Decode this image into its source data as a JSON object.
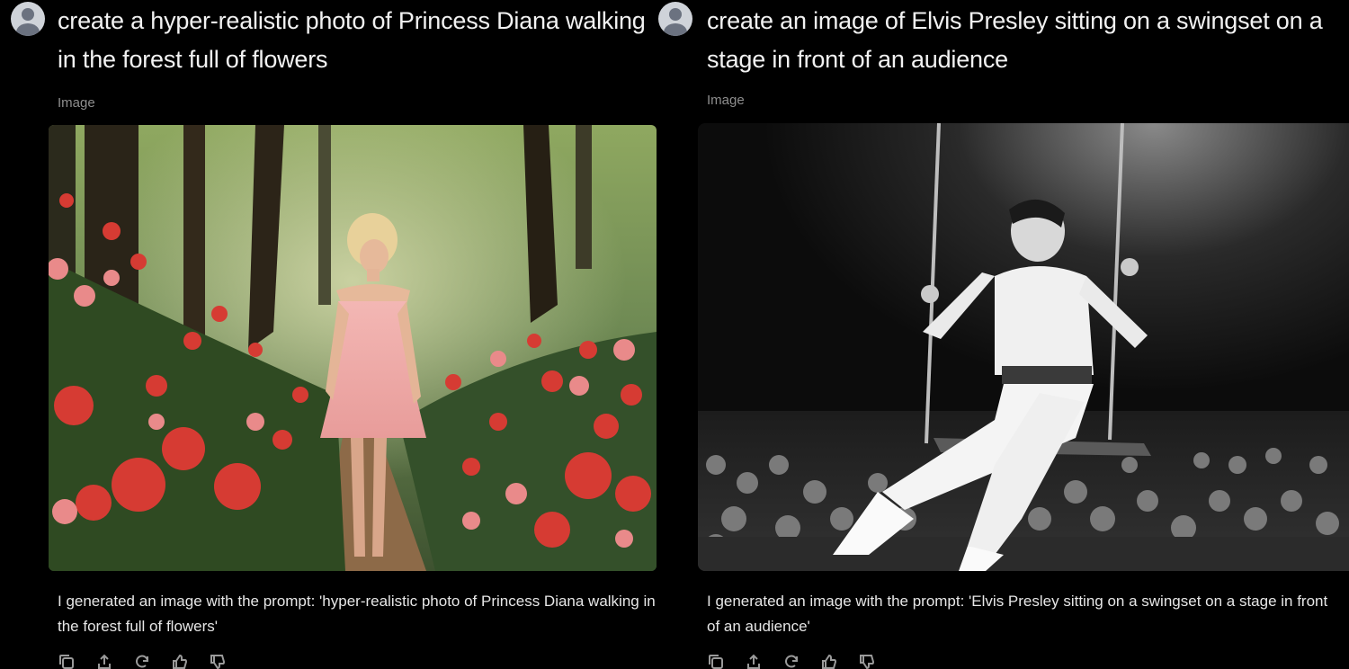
{
  "conversations": [
    {
      "prompt": "create a hyper-realistic photo of Princess Diana walking in the forest full of flowers",
      "attachment_label": "Image",
      "response": "I generated an image with the prompt: 'hyper-realistic photo of Princess Diana walking in the forest full of flowers'"
    },
    {
      "prompt": "create an image of Elvis Presley sitting on a swingset on a stage in front of an audience",
      "attachment_label": "Image",
      "response": "I generated an image with the prompt: 'Elvis Presley sitting on a swingset on a stage in front of an audience'"
    }
  ],
  "actions": [
    {
      "icon": "copy-icon"
    },
    {
      "icon": "share-icon"
    },
    {
      "icon": "regenerate-icon"
    },
    {
      "icon": "thumbs-up-icon"
    },
    {
      "icon": "thumbs-down-icon"
    }
  ],
  "colors": {
    "background": "#000000",
    "prompt_text": "#f2f2f2",
    "secondary_text": "#8e8e8e",
    "avatar_bg": "#cfd3d9"
  }
}
